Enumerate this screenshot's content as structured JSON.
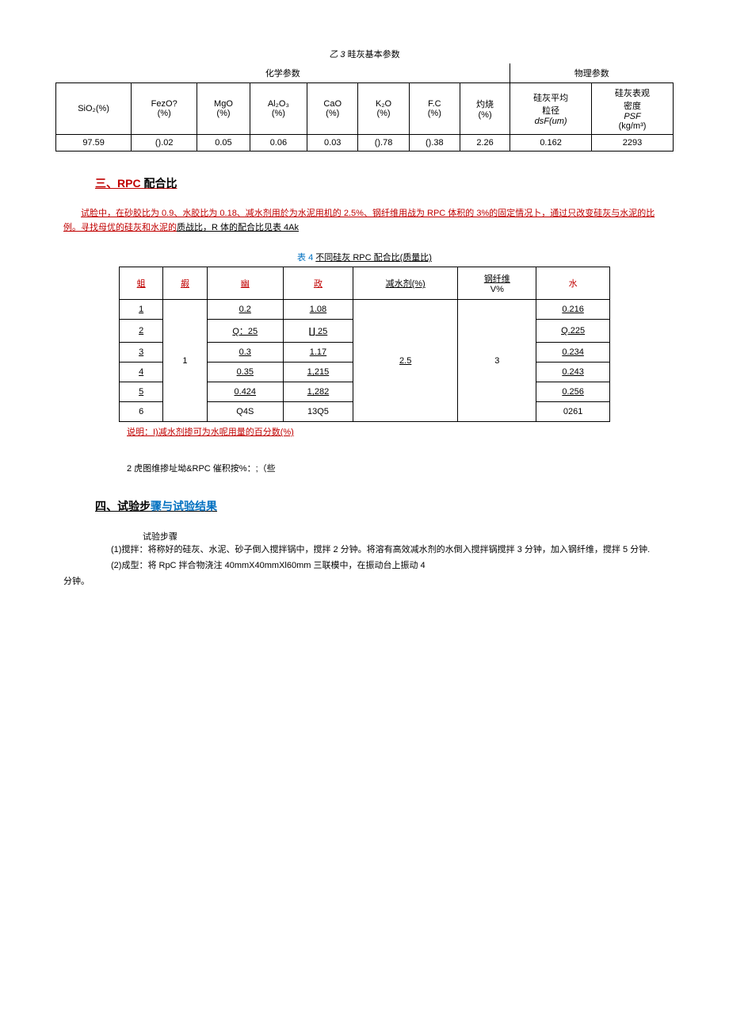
{
  "table1": {
    "caption_prefix": "乙 3",
    "caption_text": "畦灰基本参数",
    "group_chem": "化学参数",
    "group_phys": "物理参数",
    "headers": {
      "sio2": "SiO₂(%)",
      "fezo_l1": "FezO?",
      "fezo_l2": "(%)",
      "mgo_l1": "MgO",
      "mgo_l2": "(%)",
      "al2o3_l1": "Al₂O₃",
      "al2o3_l2": "(%)",
      "cao_l1": "CaO",
      "cao_l2": "(%)",
      "k2o_l1": "K₂O",
      "k2o_l2": "(%)",
      "fc_l1": "F.C",
      "fc_l2": "(%)",
      "zhuoshao_l1": "灼烧",
      "zhuoshao_l2": "(%)",
      "lijing_l1": "硅灰平均",
      "lijing_l2": "粒径",
      "lijing_l3": "dsF(um)",
      "density_l1": "硅灰表观",
      "density_l2": "密度",
      "density_l3": "PSF",
      "density_l4": "(kg/m³)"
    },
    "row": {
      "sio2": "97.59",
      "fezo": "().02",
      "mgo": "0.05",
      "al2o3": "0.06",
      "cao": "0.03",
      "k2o": "().78",
      "fc": "().38",
      "zhuoshao": "2.26",
      "lijing": "0.162",
      "density": "2293"
    }
  },
  "heading3": {
    "prefix": "三、RPC",
    "suffix": "配合比"
  },
  "para1": {
    "t1": "试脸中，在砂胶比为 0.9、水胶比为 0.18、减水剂用於为水泥用机的 2.5%、钢纤维用战为 RPC 体积的 3%的固定情况卜，通过只改变硅灰与水泥的比例。寻找母优的硅灰和水泥的",
    "t2": "质战比，R 体的配合比见表 4Ak"
  },
  "table2": {
    "caption_prefix": "表 4",
    "caption_text": "不同硅灰 RPC 配合比(质量比)",
    "headers": {
      "c1": "蛆",
      "c2": "嘏",
      "c3": "幽",
      "c4": "政",
      "c5": "减水剂(%)",
      "c6_l1": "钢纤维",
      "c6_l2": "V%",
      "c7": "水"
    },
    "c2_merged": "1",
    "c5_merged": "2.5",
    "c6_merged": "3",
    "rows": [
      {
        "c1": "1",
        "c3": "0.2",
        "c4": "1.08",
        "c7": "0.216"
      },
      {
        "c1": "2",
        "c3": "Q：25",
        "c4": "∐ 25",
        "c7": "Q.225"
      },
      {
        "c1": "3",
        "c3": "0.3",
        "c4": "1.17",
        "c7": "0.234"
      },
      {
        "c1": "4",
        "c3": "0.35",
        "c4": "1,215",
        "c7": "0.243"
      },
      {
        "c1": "5",
        "c3": "0.424",
        "c4": "1,282",
        "c7": "0.256"
      },
      {
        "c1": "6",
        "c3": "Q4S",
        "c4": "13Q5",
        "c7": "0261"
      }
    ]
  },
  "note1": "说明：I)减水剂掺可为水呢用量的百分数(%)",
  "note2": "2 虎图维掺址坳&RPC 催积按%：;（些",
  "heading4": {
    "prefix": "四、试验步",
    "suffix": "骤与试验结果"
  },
  "steps": {
    "title": "试验步骤",
    "s1": "(1)搅拌：将称好的硅灰、水泥、砂子倒入搅拌锅中，搅拌 2 分钟。将溶有高效减水剂的水倒入搅拌锅搅拌 3 分钟，加入钢纤维，搅拌 5 分钟.",
    "s2": "(2)成型：将 RpC 拌合物浇注 40mmX40mmXl60mm 三联模中，在振动台上振动 4",
    "s2b": "分钟。"
  }
}
